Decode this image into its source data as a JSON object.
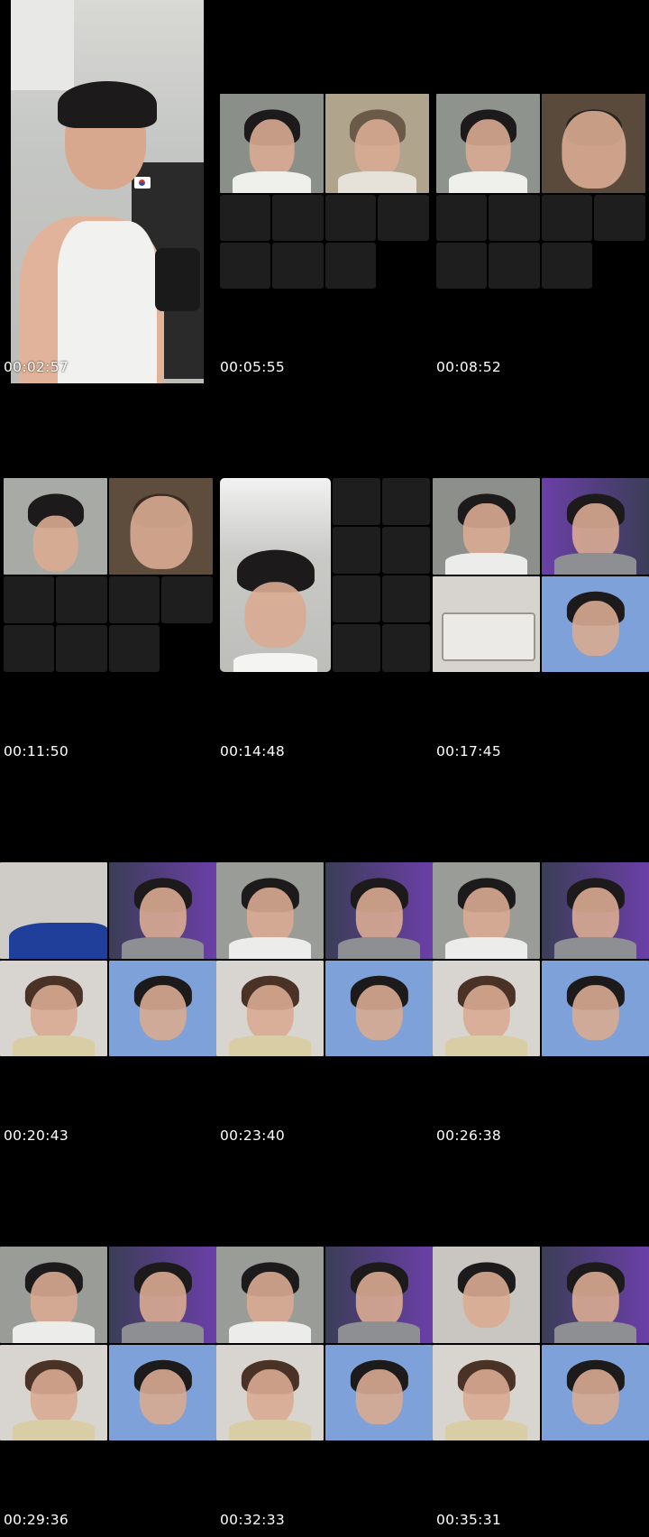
{
  "sheet": {
    "title": "",
    "timestamps": [
      "00:02:57",
      "00:05:55",
      "00:08:52",
      "00:11:50",
      "00:14:48",
      "00:17:45",
      "00:20:43",
      "00:23:40",
      "00:26:38",
      "00:29:36",
      "00:32:33",
      "00:35:31"
    ]
  },
  "colors": {
    "background": "#000000",
    "placeholder_tile": "#1e1e1e",
    "timestamp_text": "#ffffff",
    "skin": "#d9ab92",
    "hair": "#1c1a1a"
  },
  "icons": {
    "flag_sticker": "korea-flag-sticker-icon",
    "microphone": "microphone-icon",
    "headset": "headset-icon"
  }
}
